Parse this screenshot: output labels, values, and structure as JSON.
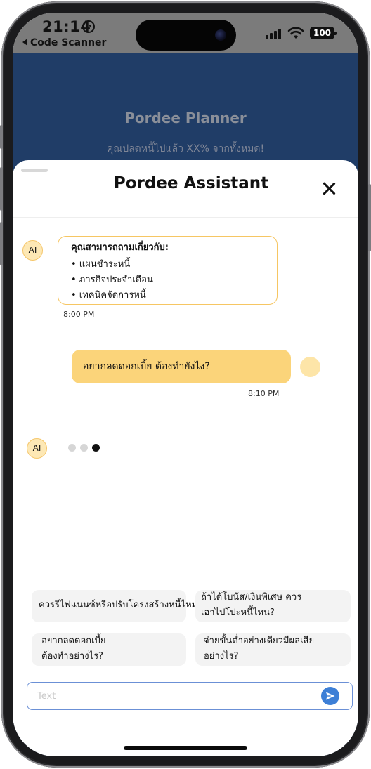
{
  "status_bar": {
    "time": "21:14",
    "back_label": "Code Scanner",
    "battery": "100"
  },
  "background_page": {
    "title": "Pordee Planner",
    "subtitle": "คุณปลดหนี้ไปแล้ว XX% จากทั้งหมด!"
  },
  "sheet": {
    "title": "Pordee Assistant"
  },
  "messages": [
    {
      "sender": "AI",
      "heading": "คุณสามารถถามเกี่ยวกับ:",
      "items": [
        "• แผนชำระหนี้",
        "• ภารกิจประจำเดือน",
        "• เทคนิคจัดการหนี้"
      ],
      "time": "8:00 PM"
    },
    {
      "sender": "user",
      "text": "อยากลดดอกเบี้ย ต้องทำยังไง?",
      "time": "8:10 PM"
    }
  ],
  "typing_sender": "AI",
  "suggestions": [
    "ควรรีไฟแนนซ์หรือปรับโครงสร้างหนี้ไหม?",
    "ถ้าได้โบนัส/เงินพิเศษ ควรเอาไปโปะหนี้ไหน?",
    "อยากลดดอกเบี้ย ต้องทำอย่างไร?",
    "จ่ายขั้นต่ำอย่างเดียวมีผลเสียอย่างไร?"
  ],
  "input": {
    "placeholder": "Text",
    "value": ""
  },
  "colors": {
    "accent": "#fbd47a",
    "accent_border": "#f6c663",
    "send": "#3d7fd6",
    "backdrop": "#203d67"
  },
  "icons": {
    "close": "close-icon",
    "send": "send-icon",
    "back": "back-arrow-icon"
  }
}
